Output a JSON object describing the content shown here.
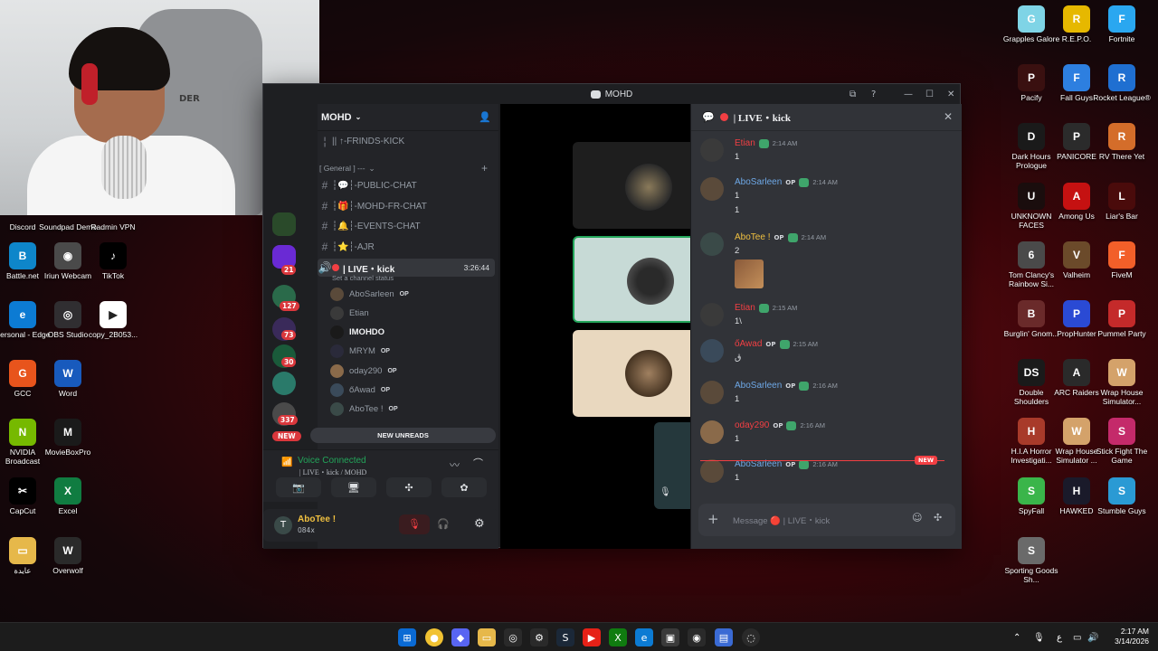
{
  "webcam": {
    "chair_text": "DER"
  },
  "desktop_left": [
    {
      "label": "Discord",
      "color": "#5865f2",
      "glyph": "D"
    },
    {
      "label": "Soundpad Demo",
      "color": "#2b2b2b",
      "glyph": "S"
    },
    {
      "label": "Radmin VPN",
      "color": "#1e5fa8",
      "glyph": "R"
    },
    {
      "label": "Battle.net",
      "color": "#0e86ca",
      "glyph": "B"
    },
    {
      "label": "Iriun Webcam",
      "color": "#4a4a4a",
      "glyph": "◉"
    },
    {
      "label": "TikTok",
      "color": "#000000",
      "glyph": "♪"
    },
    {
      "label": "Personal - Edge",
      "color": "#0c7bd3",
      "glyph": "e"
    },
    {
      "label": "OBS Studio",
      "color": "#302e31",
      "glyph": "◎"
    },
    {
      "label": "copy_2B053...",
      "color": "#ffffff",
      "glyph": "▶"
    },
    {
      "label": "GCC",
      "color": "#e8541c",
      "glyph": "G"
    },
    {
      "label": "Word",
      "color": "#185abd",
      "glyph": "W"
    },
    {
      "label": "NVIDIA Broadcast",
      "color": "#76b900",
      "glyph": "N"
    },
    {
      "label": "MovieBoxPro",
      "color": "#1a1a1a",
      "glyph": "M"
    },
    {
      "label": "CapCut",
      "color": "#000000",
      "glyph": "✂"
    },
    {
      "label": "Excel",
      "color": "#107c41",
      "glyph": "X"
    },
    {
      "label": "عايدة",
      "color": "#e6b84a",
      "glyph": "▭"
    },
    {
      "label": "Overwolf",
      "color": "#2a2a2a",
      "glyph": "W"
    }
  ],
  "desktop_right": [
    {
      "label": "Grapples Galore",
      "color": "#7fd4e6",
      "glyph": "G"
    },
    {
      "label": "R.E.P.O.",
      "color": "#e6b800",
      "glyph": "R"
    },
    {
      "label": "Fortnite",
      "color": "#2aa7f0",
      "glyph": "F"
    },
    {
      "label": "Pacify",
      "color": "#3a1010",
      "glyph": "P"
    },
    {
      "label": "Fall Guys",
      "color": "#2d7fe0",
      "glyph": "F"
    },
    {
      "label": "Rocket League®",
      "color": "#1f6fd1",
      "glyph": "R"
    },
    {
      "label": "Dark Hours Prologue",
      "color": "#1a1a1a",
      "glyph": "D"
    },
    {
      "label": "PANICORE",
      "color": "#2b2b2b",
      "glyph": "P"
    },
    {
      "label": "RV There Yet",
      "color": "#d46d2a",
      "glyph": "R"
    },
    {
      "label": "UNKNOWN FACES",
      "color": "#1a0d0d",
      "glyph": "U"
    },
    {
      "label": "Among Us",
      "color": "#c51111",
      "glyph": "A"
    },
    {
      "label": "Liar's Bar",
      "color": "#4a0b0b",
      "glyph": "L"
    },
    {
      "label": "Tom Clancy's Rainbow Si...",
      "color": "#4a4a4a",
      "glyph": "6"
    },
    {
      "label": "Valheim",
      "color": "#6b4a2a",
      "glyph": "V"
    },
    {
      "label": "FiveM",
      "color": "#f25f29",
      "glyph": "F"
    },
    {
      "label": "Burglin' Gnom...",
      "color": "#6a2a2a",
      "glyph": "B"
    },
    {
      "label": "PropHunter",
      "color": "#2a4ad4",
      "glyph": "P"
    },
    {
      "label": "Pummel Party",
      "color": "#c42a2a",
      "glyph": "P"
    },
    {
      "label": "Double Shoulders",
      "color": "#1a1a1a",
      "glyph": "DS"
    },
    {
      "label": "ARC Raiders",
      "color": "#2a2a2a",
      "glyph": "A"
    },
    {
      "label": "Wrap House Simulator...",
      "color": "#d4a26a",
      "glyph": "W"
    },
    {
      "label": "H.I.A Horror Investigati...",
      "color": "#a83a2a",
      "glyph": "H"
    },
    {
      "label": "Wrap House Simulator ...",
      "color": "#d4a26a",
      "glyph": "W"
    },
    {
      "label": "Stick Fight The Game",
      "color": "#c42a6a",
      "glyph": "S"
    },
    {
      "label": "SpyFall",
      "color": "#3ab54a",
      "glyph": "S"
    },
    {
      "label": "HAWKED",
      "color": "#1a1a2a",
      "glyph": "H"
    },
    {
      "label": "Stumble Guys",
      "color": "#2a9ad4",
      "glyph": "S"
    },
    {
      "label": "Sporting Goods Sh...",
      "color": "#6a6a6a",
      "glyph": "S"
    }
  ],
  "window": {
    "title": "MOHD"
  },
  "guild_badges": [
    "21",
    "127",
    "73",
    "30",
    "337"
  ],
  "guild_new": "NEW",
  "server": {
    "name": "MOHD"
  },
  "channels": {
    "top_channel": "|| ↑-FRINDS-KICK",
    "category": "[ General ] ---",
    "list": [
      "┆💬┆-PUBLIC-CHAT",
      "┆🎁┆-MOHD-FR-CHAT",
      "┆🔔┆-EVENTS-CHAT",
      "┆⭐┆-AJR"
    ],
    "voice_channel": "| LIVE・kick",
    "voice_timer": "3:26:44",
    "channel_status": "Set a channel status",
    "voice_users": [
      {
        "name": "AboSarleen",
        "op": "OP",
        "color": "#5a4a3a"
      },
      {
        "name": "Etian",
        "op": "",
        "color": "#3a3a3a"
      },
      {
        "name": "IMOHDO",
        "op": "",
        "color": "#1a1a1a"
      },
      {
        "name": "MRYM",
        "op": "OP",
        "color": "#2a2a3a"
      },
      {
        "name": "oday290",
        "op": "OP",
        "color": "#8a6a4a"
      },
      {
        "name": "őAwad",
        "op": "OP",
        "color": "#3a4a5a"
      },
      {
        "name": "AboTee !",
        "op": "OP",
        "color": "#3a4a48"
      }
    ],
    "new_unreads": "NEW UNREADS"
  },
  "voice": {
    "status": "Voice Connected",
    "location": "| LIVE・kick / MOHD"
  },
  "user": {
    "name": "AboTee !",
    "tag": "084x"
  },
  "chat": {
    "header": "| LIVE・kick",
    "messages": [
      {
        "name": "Etian",
        "name_color": "#f23f43",
        "op": "",
        "time": "2:14 AM",
        "lines": [
          "1"
        ],
        "avatar": "#3a3a3a"
      },
      {
        "name": "AboSarleen",
        "name_color": "#6ea8e6",
        "op": "OP",
        "time": "2:14 AM",
        "lines": [
          "1",
          "1"
        ],
        "avatar": "#5a4a3a"
      },
      {
        "name": "AboTee !",
        "name_color": "#f0c040",
        "op": "OP",
        "time": "2:14 AM",
        "lines": [
          "2"
        ],
        "avatar": "#3a4a48"
      },
      {
        "name": "Etian",
        "name_color": "#f23f43",
        "op": "",
        "time": "2:15 AM",
        "lines": [
          "1\\"
        ],
        "avatar": "#3a3a3a"
      },
      {
        "name": "őAwad",
        "name_color": "#f23f43",
        "op": "OP",
        "time": "2:15 AM",
        "lines": [
          "ق"
        ],
        "avatar": "#3a4a5a"
      },
      {
        "name": "AboSarleen",
        "name_color": "#6ea8e6",
        "op": "OP",
        "time": "2:16 AM",
        "lines": [
          "1"
        ],
        "avatar": "#5a4a3a"
      },
      {
        "name": "oday290",
        "name_color": "#f23f43",
        "op": "OP",
        "time": "2:16 AM",
        "lines": [
          "1"
        ],
        "avatar": "#8a6a4a"
      },
      {
        "name": "AboSarleen",
        "name_color": "#6ea8e6",
        "op": "OP",
        "time": "2:16 AM",
        "lines": [
          "1"
        ],
        "avatar": "#5a4a3a"
      }
    ],
    "new_tag": "NEW",
    "composer_placeholder": "Message 🔴 | LIVE・kick"
  },
  "taskbar": {
    "time": "2:17 AM",
    "date": "3/14/2026",
    "lang": "ع"
  }
}
